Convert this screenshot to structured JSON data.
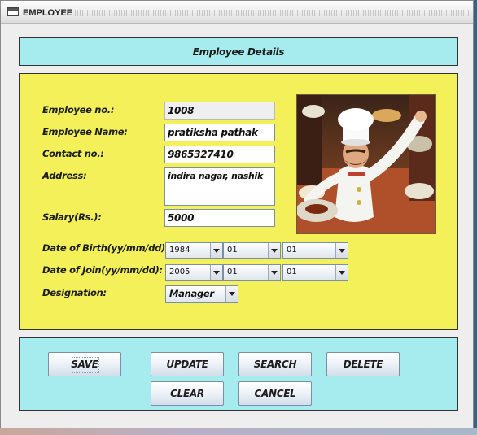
{
  "window": {
    "title": "EMPLOYEE"
  },
  "header": {
    "title": "Employee Details"
  },
  "form": {
    "employee_no": {
      "label": "Employee no.:",
      "value": "1008"
    },
    "employee_name": {
      "label": "Employee Name:",
      "value": "pratiksha pathak"
    },
    "contact_no": {
      "label": "Contact no.:",
      "value": "9865327410"
    },
    "address": {
      "label": "Address:",
      "value": "indira nagar, nashik"
    },
    "salary": {
      "label": "Salary(Rs.):",
      "value": "5000"
    },
    "dob": {
      "label": "Date of Birth(yy/mm/dd):",
      "year": "1984",
      "month": "01",
      "day": "01"
    },
    "doj": {
      "label": "Date of Join(yy/mm/dd):",
      "year": "2005",
      "month": "01",
      "day": "01"
    },
    "designation": {
      "label": "Designation:",
      "value": "Manager"
    }
  },
  "photo": {
    "icon": "chef-photo"
  },
  "buttons": {
    "save": "SAVE",
    "update": "UPDATE",
    "search": "SEARCH",
    "delete": "DELETE",
    "clear": "CLEAR",
    "cancel": "CANCEL"
  },
  "colors": {
    "header_bg": "#a6ecee",
    "form_bg": "#f3f05a",
    "button_panel_bg": "#a6ecee"
  }
}
